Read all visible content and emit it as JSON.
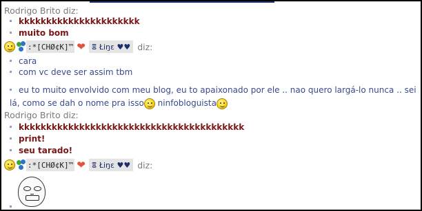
{
  "conversation": {
    "block1": {
      "sender": "Rodrigo Brito diz:",
      "messages": [
        "kkkkkkkkkkkkkkkkkkkkkk",
        "muito bom"
      ]
    },
    "nick_header": {
      "nick_box_text": ":*[CHØ¢K]™",
      "nick_box2_text": "ⴻ Łiŋɛ ♥♥",
      "diz": "diz:"
    },
    "block2": {
      "messages": [
        "cara",
        "com vc deve ser assim tbm",
        "eu to muito envolvido com meu blog, eu to apaixonado por ele  .. nao quero largá-lo nunca  .. sei lá, como se dah o nome pra isso",
        "ninfobloguista"
      ]
    },
    "block3": {
      "sender": "Rodrigo Brito diz:",
      "messages": [
        "kkkkkkkkkkkkkkkkkkkkkkkkkkkkkkkkkkkkkkkkk",
        "print!",
        "seu tarado!"
      ]
    },
    "nick_header2": {
      "nick_box_text": ":*[CHØ¢K]™",
      "nick_box2_text": "ⴻ Łiŋɛ ♥♥",
      "diz": "diz:"
    }
  },
  "icons": {
    "smiley": "smiley-icon",
    "msn": "msn-buddy-icon",
    "heart": "heart-icon",
    "thinking": "thinking-emoticon",
    "meme": "me-gusta-face"
  },
  "colors": {
    "bold_text": "#7a1616",
    "plain_text": "#3a4a8c",
    "sender_text": "#7a7a7a"
  }
}
